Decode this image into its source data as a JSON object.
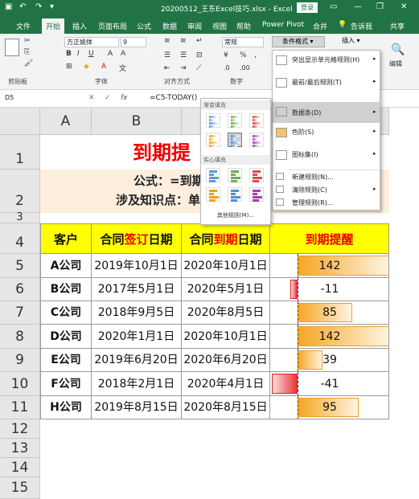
{
  "titlebar": {
    "title": "20200512_王东Excel技巧.xlsx - Excel",
    "login": "登录"
  },
  "ribbon_tabs": [
    "文件",
    "开始",
    "插入",
    "页面布局",
    "公式",
    "数据",
    "审阅",
    "视图",
    "帮助",
    "Power Pivot",
    "合并",
    "告诉我",
    "共享"
  ],
  "ribbon": {
    "font_name": "方正姚体",
    "font_size": "9",
    "number_format": "常规",
    "cond_format": "条件格式",
    "insert": "插入",
    "edit": "编辑",
    "groups": [
      "剪贴板",
      "字体",
      "对齐方式",
      "数字"
    ]
  },
  "formula_bar": {
    "name_box": "D5",
    "fx": "fx",
    "formula": "=C5-TODAY()"
  },
  "sheet": {
    "col_headers": [
      "A",
      "B",
      "C",
      "D"
    ],
    "row_headers": [
      "1",
      "2",
      "3",
      "4",
      "5",
      "6",
      "7",
      "8",
      "9",
      "10",
      "11",
      "12",
      "13",
      "14",
      "15"
    ],
    "title": "到期提",
    "formula_label": "公式：=到期单",
    "knowledge_label": "涉及知识点：单",
    "table_headers": {
      "customer": "客户",
      "sign_pre": "合同",
      "sign_mid": "签订",
      "sign_post": "日期",
      "due_pre": "合同",
      "due_mid": "到期",
      "due_post": "日期",
      "remind": "到期提醒"
    },
    "rows": [
      {
        "customer": "A公司",
        "signed": "2019年10月1日",
        "due": "2020年10月1日",
        "remind": "142"
      },
      {
        "customer": "B公司",
        "signed": "2017年5月1日",
        "due": "2020年5月1日",
        "remind": "-11"
      },
      {
        "customer": "C公司",
        "signed": "2018年9月5日",
        "due": "2020年8月5日",
        "remind": "85"
      },
      {
        "customer": "D公司",
        "signed": "2020年1月1日",
        "due": "2020年10月1日",
        "remind": "142"
      },
      {
        "customer": "E公司",
        "signed": "2019年6月20日",
        "due": "2020年6月20日",
        "remind": "39"
      },
      {
        "customer": "F公司",
        "signed": "2018年2月1日",
        "due": "2020年4月1日",
        "remind": "-41"
      },
      {
        "customer": "H公司",
        "signed": "2019年8月15日",
        "due": "2020年8月15日",
        "remind": "95"
      }
    ]
  },
  "cf_menu": {
    "items": [
      "突出显示单元格规则(H)",
      "最前/最后规则(T)",
      "数据条(D)",
      "色阶(S)",
      "图标集(I)",
      "新建规则(N)...",
      "清除规则(C)",
      "管理规则(R)..."
    ]
  },
  "gallery": {
    "gradient_title": "渐变填充",
    "solid_title": "实心填充",
    "more_rules": "其他规则(M)...",
    "colors": [
      "#5b9bd5",
      "#70ad47",
      "#e0474c",
      "#f0a30a",
      "#4a90d9",
      "#a73fb1"
    ]
  },
  "colors": {
    "excel_green": "#217346",
    "header_yellow": "#ffff00",
    "bar_orange": "#f5a623",
    "bar_red": "#e8363a",
    "text_red": "#ee0000"
  }
}
